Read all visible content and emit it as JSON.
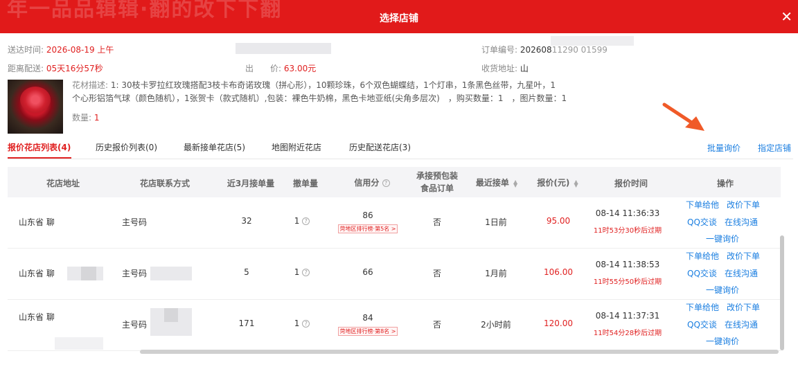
{
  "dialog": {
    "title": "选择店铺",
    "bg_text": "年一品品辑辑·翻的改下下翻"
  },
  "info": {
    "send_time_label": "送达时间:",
    "send_time_value": "2026-08-19 上午",
    "distance_label": "距离配送:",
    "distance_value": "05天16分57秒",
    "order_no_label": "订单编号:",
    "order_no_value": "202608",
    "order_no_tail": "11290 01599",
    "price_label": "出　　价:",
    "price_value": "63.00元",
    "address_label": "收货地址:",
    "address_value": "山"
  },
  "flower": {
    "desc_label": "花材描述:",
    "desc_line1": " 1:  30枝卡罗拉红玫瑰搭配3枝卡布奇诺玫瑰（拼心形），10颗珍珠，6个双色蝴蝶结，1个灯串，1条黑色丝带，九星叶，1",
    "desc_line2": "个心形铝箔气球（颜色随机），1张贺卡（款式随机）,包装：裸色牛奶棉，黑色卡地亚纸(尖角多层次)　，购买数量：1　，图片数量：1",
    "qty_label": "数量:",
    "qty_value": "1"
  },
  "tabs": [
    {
      "label": "报价花店列表(4)"
    },
    {
      "label": "历史报价列表(0)"
    },
    {
      "label": "最新接单花店(5)"
    },
    {
      "label": "地图附近花店"
    },
    {
      "label": "历史配送花店(3)"
    }
  ],
  "actions": {
    "batch_inquiry": "批量询价",
    "assign_shop": "指定店铺"
  },
  "table": {
    "headers": {
      "address": "花店地址",
      "contact": "花店联系方式",
      "orders3m": "近3月接单量",
      "cancel": "撤单量",
      "credit": "信用分",
      "prepack_line1": "承接预包装",
      "prepack_line2": "食品订单",
      "recent": "最近接单",
      "quote": "报价(元)",
      "quote_time": "报价时间",
      "ops": "操作"
    },
    "rows": [
      {
        "address": "山东省 聊",
        "contact": "主号码",
        "orders3m": "32",
        "cancel": "1",
        "credit": "86",
        "badge": "菏地区排行榜·第5名 >",
        "prepack": "否",
        "recent": "1日前",
        "quote": "95.00",
        "time": "08-14 11:36:33",
        "expire": "11时53分30秒后过期"
      },
      {
        "address": "山东省 聊",
        "contact": "主号码",
        "orders3m": "5",
        "cancel": "1",
        "credit": "66",
        "badge": "",
        "prepack": "否",
        "recent": "1月前",
        "quote": "106.00",
        "time": "08-14 11:38:53",
        "expire": "11时55分50秒后过期"
      },
      {
        "address": "山东省 聊",
        "contact": "主号码",
        "orders3m": "171",
        "cancel": "1",
        "credit": "84",
        "badge": "菏地区排行榜·第8名 >",
        "prepack": "否",
        "recent": "2小时前",
        "quote": "120.00",
        "time": "08-14 11:37:31",
        "expire": "11时54分28秒后过期"
      }
    ],
    "ops": {
      "order": "下单给他",
      "change_price": "改价下单",
      "qq": "QQ交谈",
      "online": "在线沟通",
      "inquiry": "一键询价"
    }
  },
  "colors": {
    "brand_red": "#e11a1a",
    "link_blue": "#1a7ee0",
    "price_red": "#e02020",
    "arrow_orange": "#f05a28"
  }
}
